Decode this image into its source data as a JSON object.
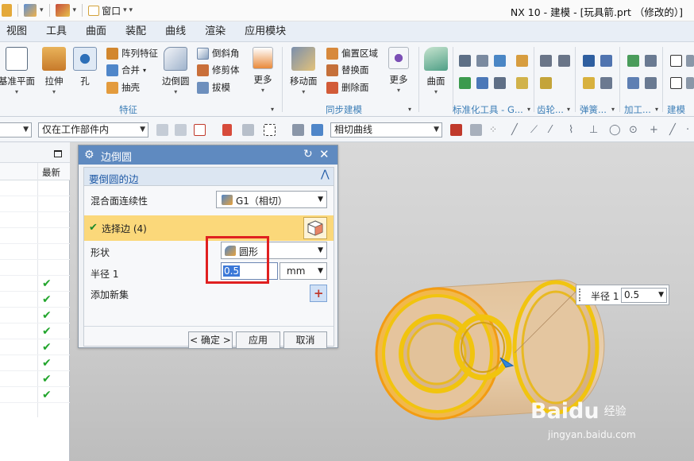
{
  "window": {
    "title": "NX 10 - 建模 - [玩具箭.prt （修改的）]",
    "window_menu_label": "窗口"
  },
  "menubar": [
    "视图",
    "工具",
    "曲面",
    "装配",
    "曲线",
    "渲染",
    "应用模块"
  ],
  "ribbon": {
    "datum_plane": "基准平面",
    "extrude": "拉伸",
    "hole": "孔",
    "pattern_feature": "阵列特征",
    "unite": "合并",
    "shell": "抽壳",
    "edge_blend": "边倒圆",
    "chamfer": "倒斜角",
    "trim_body": "修剪体",
    "draft": "拔模",
    "more_1": "更多",
    "feature_group": "特征",
    "move_face": "移动面",
    "offset_region": "偏置区域",
    "replace_face": "替换面",
    "delete_face": "删除面",
    "more_2": "更多",
    "sync_group": "同步建模",
    "surface": "曲面",
    "std_tools_group": "标准化工具 - G...",
    "gear_group": "齿轮...",
    "spring_group": "弹簧...",
    "process_group": "加工...",
    "build_tools_group": "建模工"
  },
  "selbar": {
    "filter_value": "",
    "scope_value": "仅在工作部件内",
    "curve_rule_value": "相切曲线"
  },
  "navigator": {
    "latest_header": "最新",
    "check_count": 8
  },
  "dialog": {
    "title": "边倒圆",
    "section_title": "要倒圆的边",
    "continuity_label": "混合面连续性",
    "continuity_value": "G1（相切）",
    "select_edge_label": "选择边 (4)",
    "shape_label": "形状",
    "shape_value": "圆形",
    "radius_label": "半径 1",
    "radius_value": "0.5",
    "radius_unit": "mm",
    "add_set_label": "添加新集",
    "ok_label": "< 确定 >",
    "apply_label": "应用",
    "cancel_label": "取消"
  },
  "canvas_tip": {
    "label": "半径 1",
    "value": "0.5"
  },
  "watermark": {
    "brand": "Baidu",
    "sub": "经验",
    "url": "jingyan.baidu.com"
  },
  "colors": {
    "accent": "#5f8ac0",
    "highlight_row": "#fbd87a",
    "edge_highlight": "#f1c40f",
    "check": "#22a52c",
    "annotation_box": "#e02020",
    "part_body": "#e8c9a0"
  }
}
